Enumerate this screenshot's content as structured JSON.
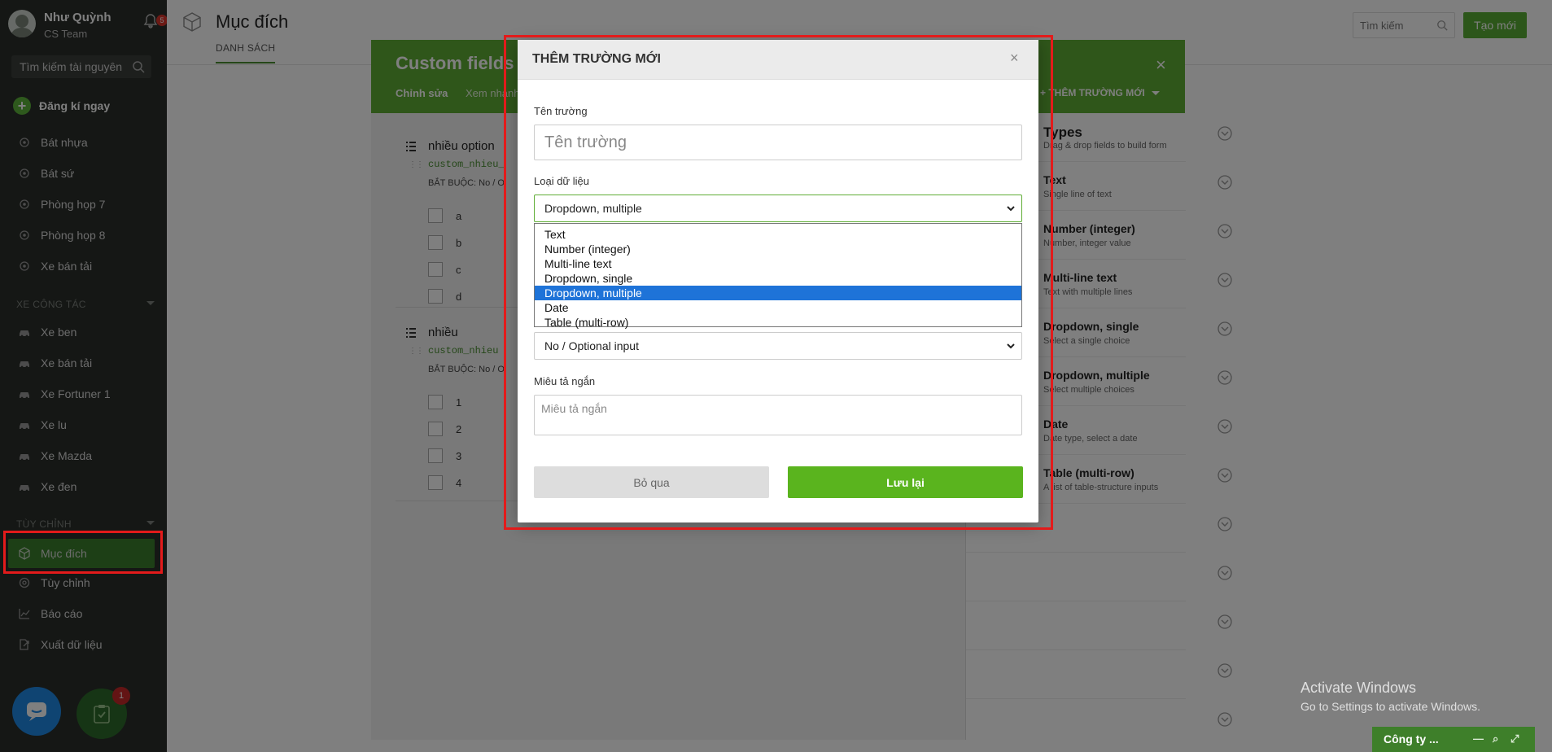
{
  "user": {
    "name": "Như Quỳnh",
    "team": "CS Team",
    "notif_count": "5"
  },
  "sidebar": {
    "search_placeholder": "Tìm kiếm tài nguyên",
    "register_label": "Đăng kí ngay",
    "rooms": [
      "Bát nhựa",
      "Bát sứ",
      "Phòng họp 7",
      "Phòng họp 8",
      "Xe bán tải"
    ],
    "section_vehicles": "XE CÔNG TÁC",
    "vehicles": [
      "Xe ben",
      "Xe bán tải",
      "Xe Fortuner 1",
      "Xe lu",
      "Xe Mazda",
      "Xe đen"
    ],
    "section_custom": "TÙY CHỈNH",
    "custom_items": [
      "Mục đích",
      "Tùy chỉnh",
      "Báo cáo",
      "Xuất dữ liệu"
    ],
    "task_badge": "1"
  },
  "topbar": {
    "title": "Mục đích",
    "tab": "DANH SÁCH",
    "search_placeholder": "Tìm kiếm",
    "create_label": "Tạo mới"
  },
  "custom_fields": {
    "title": "Custom fields",
    "tab_edit": "Chỉnh sửa",
    "tab_preview": "Xem nhanh",
    "add_field": "THÊM TRƯỜNG MỚI",
    "close": "×",
    "groups": [
      {
        "title": "nhiều option",
        "code": "custom_nhieu_",
        "required": "BẮT BUỘC: No / O",
        "options": [
          "a",
          "b",
          "c",
          "d"
        ]
      },
      {
        "title": "nhiều",
        "code": "custom_nhieu",
        "required": "BẮT BUỘC: No / O",
        "options": [
          "1",
          "2",
          "3",
          "4"
        ]
      }
    ],
    "types_header": {
      "name": "Types",
      "desc": "Drag & drop fields to build form"
    },
    "types": [
      {
        "name": "Text",
        "desc": "Single line of text"
      },
      {
        "name": "Number (integer)",
        "desc": "Number, integer value"
      },
      {
        "name": "Multi-line text",
        "desc": "Text with multiple lines"
      },
      {
        "name": "Dropdown, single",
        "desc": "Select a single choice"
      },
      {
        "name": "Dropdown, multiple",
        "desc": "Select multiple choices"
      },
      {
        "name": "Date",
        "desc": "Date type, select a date"
      },
      {
        "name": "Table (multi-row)",
        "desc": "A list of table-structure inputs"
      }
    ]
  },
  "modal": {
    "title": "THÊM TRƯỜNG MỚI",
    "close": "×",
    "field_name_label": "Tên trường",
    "field_name_placeholder": "Tên trường",
    "data_type_label": "Loại dữ liệu",
    "data_type_value": "Dropdown, multiple",
    "data_type_options": [
      "Text",
      "Number (integer)",
      "Multi-line text",
      "Dropdown, single",
      "Dropdown, multiple",
      "Date",
      "Table (multi-row)"
    ],
    "data_type_selected_index": 4,
    "required_value": "No / Optional input",
    "short_desc_label": "Miêu tả ngắn",
    "short_desc_placeholder": "Miêu tả ngắn",
    "skip_label": "Bỏ qua",
    "save_label": "Lưu lại"
  },
  "watermark": {
    "line1": "Activate Windows",
    "line2": "Go to Settings to activate Windows."
  },
  "company_bar": {
    "label": "Công ty ..."
  },
  "colors": {
    "brand_green": "#5fad35",
    "highlight_red": "#e31b1b",
    "selected_blue": "#1e73d8"
  }
}
